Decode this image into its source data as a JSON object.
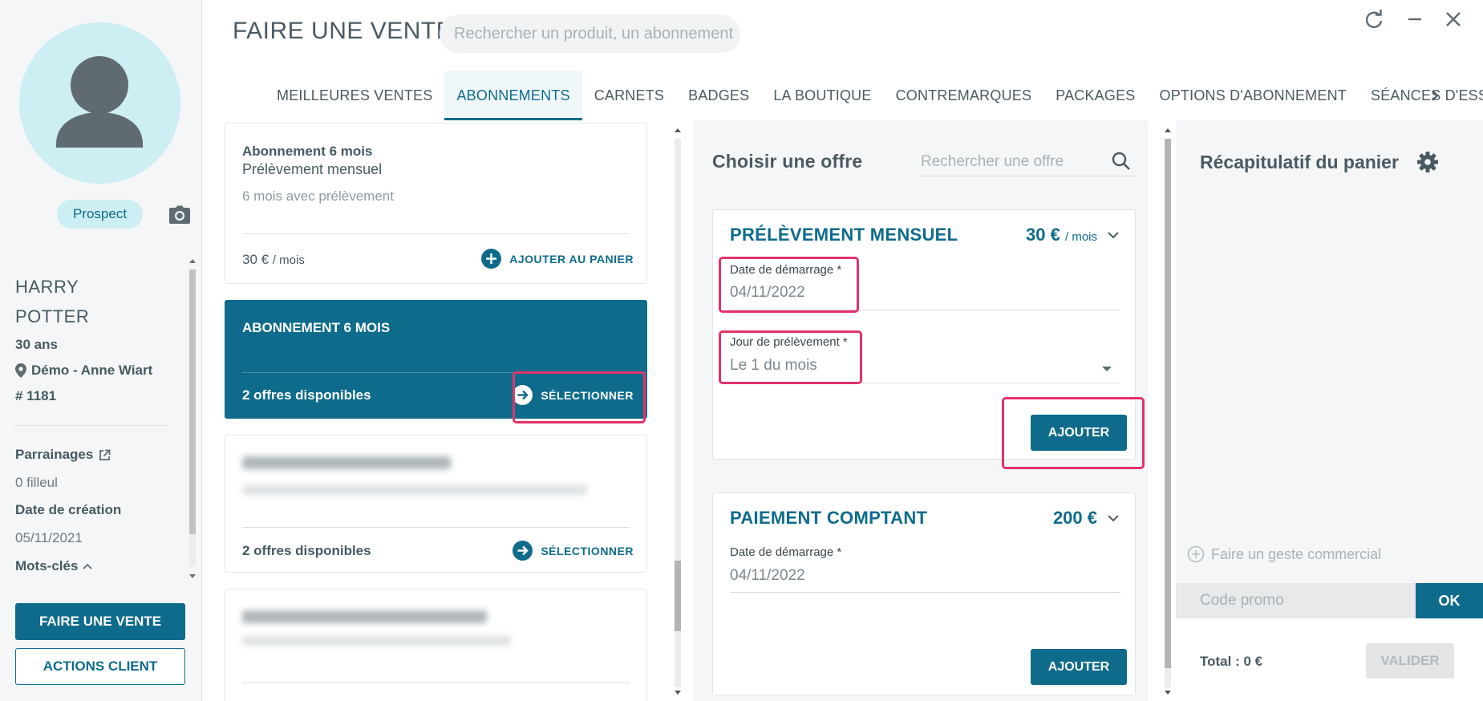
{
  "header": {
    "title": "FAIRE UNE VENTE",
    "search_placeholder": "Rechercher un produit, un abonnement"
  },
  "tabs": [
    {
      "label": "MEILLEURES VENTES",
      "active": false
    },
    {
      "label": "ABONNEMENTS",
      "active": true
    },
    {
      "label": "CARNETS",
      "active": false
    },
    {
      "label": "BADGES",
      "active": false
    },
    {
      "label": "LA BOUTIQUE",
      "active": false
    },
    {
      "label": "CONTREMARQUES",
      "active": false
    },
    {
      "label": "PACKAGES",
      "active": false
    },
    {
      "label": "OPTIONS D'ABONNEMENT",
      "active": false
    },
    {
      "label": "SÉANCES D'ESSA",
      "active": false
    }
  ],
  "client": {
    "status": "Prospect",
    "first_name": "HARRY",
    "last_name": "POTTER",
    "age": "30 ans",
    "location": "Démo - Anne Wiart",
    "id": "# 1181",
    "referrals_label": "Parrainages",
    "referrals_value": "0 filleul",
    "creation_label": "Date de création",
    "creation_value": "05/11/2021",
    "keywords_label": "Mots-clés",
    "sale_button": "FAIRE UNE VENTE",
    "actions_button": "ACTIONS CLIENT"
  },
  "products": {
    "card1": {
      "title": "Abonnement 6 mois",
      "subtitle": "Prélèvement mensuel",
      "description": "6 mois avec prélèvement",
      "price": "30 €",
      "price_unit": "/ mois",
      "action": "AJOUTER AU PANIER"
    },
    "card2": {
      "title": "ABONNEMENT 6 MOIS",
      "offers": "2 offres disponibles",
      "action": "SÉLECTIONNER"
    },
    "card3": {
      "offers": "2 offres disponibles",
      "action": "SÉLECTIONNER"
    }
  },
  "offers": {
    "title": "Choisir une offre",
    "search_placeholder": "Rechercher une offre",
    "monthly": {
      "title": "PRÉLÈVEMENT MENSUEL",
      "price": "30 €",
      "price_unit": "/ mois",
      "start_label": "Date de démarrage *",
      "start_value": "04/11/2022",
      "day_label": "Jour de prélèvement *",
      "day_value": "Le 1 du mois",
      "add_button": "AJOUTER"
    },
    "cash": {
      "title": "PAIEMENT COMPTANT",
      "price": "200 €",
      "start_label": "Date de démarrage *",
      "start_value": "04/11/2022",
      "add_button": "AJOUTER"
    }
  },
  "cart": {
    "title": "Récapitulatif du panier",
    "gesture": "Faire un geste commercial",
    "promo_placeholder": "Code promo",
    "ok_button": "OK",
    "total": "Total : 0 €",
    "validate_button": "VALIDER"
  },
  "colors": {
    "primary": "#0e6b8c",
    "highlight": "#e3336b",
    "avatar_bg": "#cdeef3"
  }
}
